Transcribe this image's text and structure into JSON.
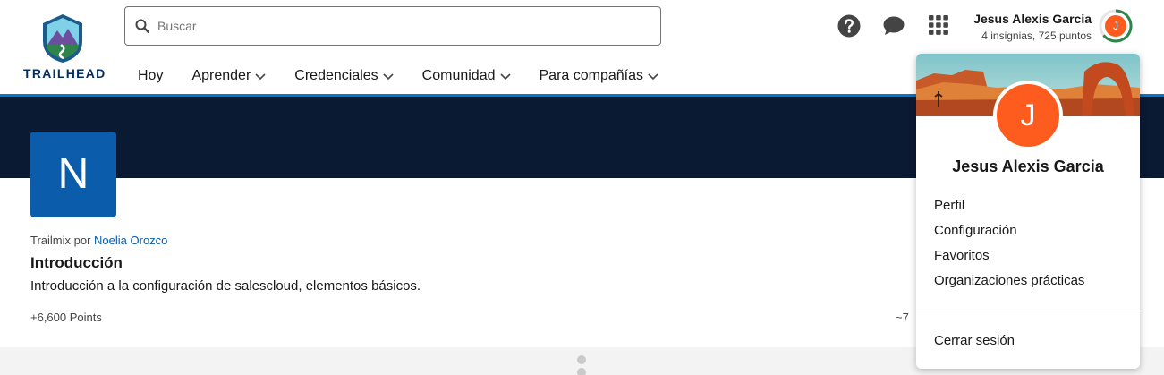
{
  "brand": {
    "logo_text": "TRAILHEAD"
  },
  "search": {
    "placeholder": "Buscar",
    "value": ""
  },
  "nav": {
    "items": [
      {
        "label": "Hoy",
        "has_menu": false
      },
      {
        "label": "Aprender",
        "has_menu": true
      },
      {
        "label": "Credenciales",
        "has_menu": true
      },
      {
        "label": "Comunidad",
        "has_menu": true
      },
      {
        "label": "Para compañías",
        "has_menu": true
      }
    ]
  },
  "header_icons": [
    "help-icon",
    "chat-icon",
    "app-launcher-icon"
  ],
  "user": {
    "name": "Jesus Alexis Garcia",
    "stats": "4 insignias, 725 puntos",
    "initial": "J"
  },
  "trailmix": {
    "tile_letter": "N",
    "byline_prefix": "Trailmix por",
    "author": "Noelia Orozco",
    "title": "Introducción",
    "description": "Introducción a la configuración de salescloud, elementos básicos.",
    "points": "+6,600 Points",
    "duration": "~7"
  },
  "dropdown": {
    "name": "Jesus Alexis Garcia",
    "initial": "J",
    "items": [
      "Perfil",
      "Configuración",
      "Favoritos",
      "Organizaciones prácticas"
    ],
    "logout": "Cerrar sesión"
  },
  "colors": {
    "brand_blue": "#0176d3",
    "banner_navy": "#0b1a33",
    "tile_blue": "#0b5cab",
    "avatar_orange": "#fe5c1e",
    "progress_green": "#2e844a"
  }
}
